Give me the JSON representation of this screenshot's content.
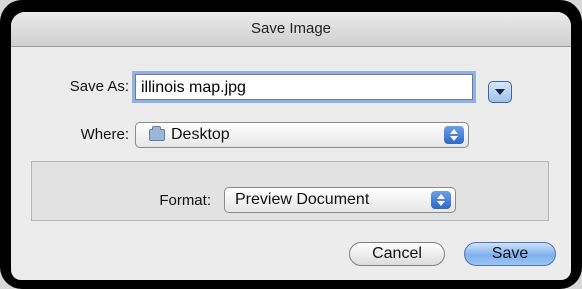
{
  "dialog": {
    "title": "Save Image",
    "save_as_label": "Save As:",
    "filename_value": "illinois map.jpg",
    "where_label": "Where:",
    "where_value": "Desktop",
    "format_label": "Format:",
    "format_value": "Preview Document"
  },
  "buttons": {
    "cancel_label": "Cancel",
    "save_label": "Save"
  },
  "icons": {
    "expand": "chevron-down-icon",
    "folder": "folder-icon",
    "stepper": "up-down-stepper-icon"
  },
  "colors": {
    "default_button": "#7fb0ee",
    "focus_ring": "#8db2e3"
  }
}
